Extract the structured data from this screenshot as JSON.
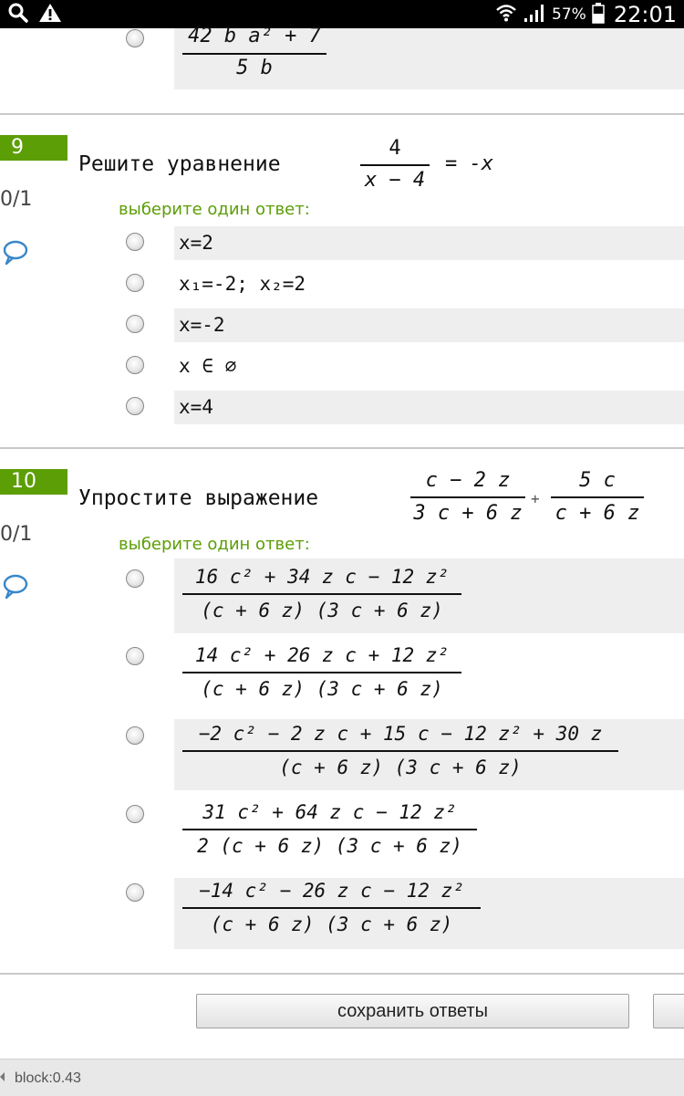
{
  "status_bar": {
    "icons": [
      "search-icon",
      "warning-icon",
      "wifi-icon",
      "signal-icon",
      "battery-icon"
    ],
    "battery": "57%",
    "time": "22:01"
  },
  "q8_tail": {
    "option_last": {
      "numerator": "42 b a² + 7",
      "denominator": "5 b"
    }
  },
  "q9": {
    "number": "9",
    "score": "0/1",
    "text": "Решите уравнение",
    "eq_numerator": "4",
    "eq_denominator": "x − 4",
    "eq_rhs": "= -x",
    "prompt": "выберите один ответ:",
    "options": [
      "x=2",
      "x₁=-2; x₂=2",
      "x=-2",
      "x ∈ ∅",
      "x=4"
    ]
  },
  "q10": {
    "number": "10",
    "score": "0/1",
    "text": "Упростите выражение",
    "expr1_numerator": "c − 2 z",
    "expr1_denominator": "3 c + 6 z",
    "expr_plus": "+",
    "expr2_numerator": "5 c",
    "expr2_denominator": "c + 6 z",
    "prompt": "выберите один ответ:",
    "options": [
      {
        "numerator": "16 c² + 34 z c − 12 z²",
        "denominator": "(c + 6 z) (3 c + 6 z)"
      },
      {
        "numerator": "14 c² + 26 z c + 12 z²",
        "denominator": "(c + 6 z) (3 c + 6 z)"
      },
      {
        "numerator": "−2 c² − 2 z c + 15 c − 12 z² + 30 z",
        "denominator": "(c + 6 z) (3 c + 6 z)"
      },
      {
        "numerator": "31 c² + 64 z c − 12 z²",
        "denominator": "2 (c + 6 z) (3 c + 6 z)"
      },
      {
        "numerator": "−14 c² − 26 z c − 12 z²",
        "denominator": "(c + 6 z) (3 c + 6 z)"
      }
    ]
  },
  "actions": {
    "save_label": "сохранить ответы"
  },
  "footer": {
    "text": "block:0.43"
  },
  "colors": {
    "accent": "#5c9e06",
    "shade": "#eeeeee"
  }
}
